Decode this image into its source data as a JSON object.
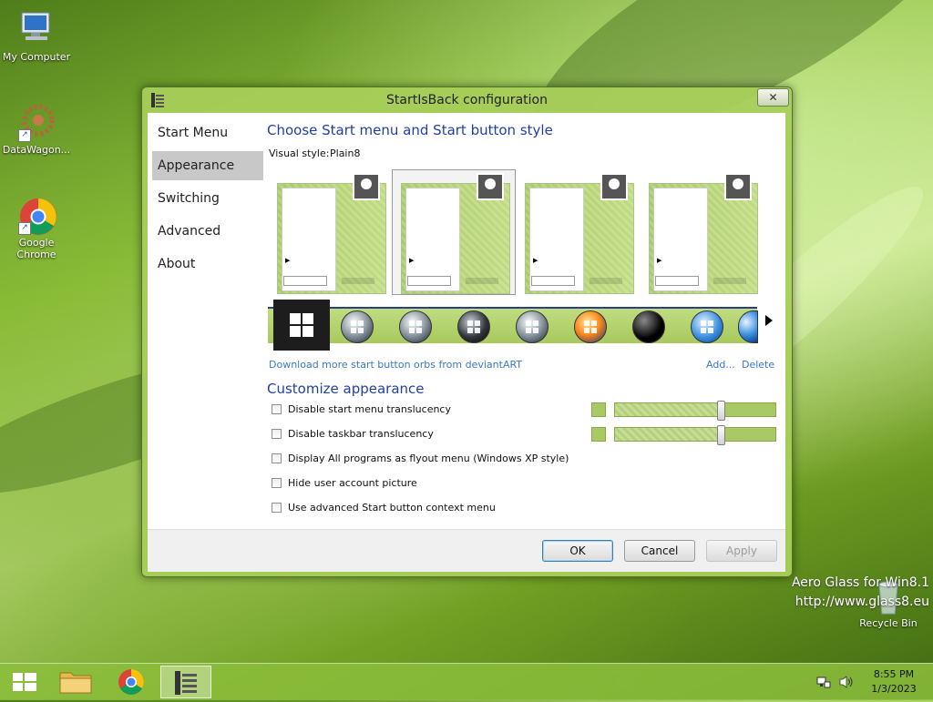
{
  "desktop": {
    "icons": [
      {
        "label": "My Computer"
      },
      {
        "label": "DataWagon..."
      },
      {
        "label": "Google Chrome"
      },
      {
        "label": "Recycle Bin"
      }
    ],
    "watermark": {
      "line1": "Aero Glass for Win8.1",
      "line2": "http://www.glass8.eu"
    }
  },
  "window": {
    "title": "StartIsBack configuration",
    "close_glyph": "✕",
    "nav": {
      "items": [
        {
          "label": "Start Menu"
        },
        {
          "label": "Appearance"
        },
        {
          "label": "Switching"
        },
        {
          "label": "Advanced"
        },
        {
          "label": "About"
        }
      ],
      "selected": "Appearance"
    },
    "style_section": {
      "heading": "Choose Start menu and Start button style",
      "visual_style_label": "Visual style:",
      "visual_style_value": "Plain8",
      "selected_preview_index": 1,
      "orbs_link": "Download more start button orbs from deviantART",
      "add_link": "Add...",
      "delete_link": "Delete"
    },
    "customize_section": {
      "heading": "Customize appearance",
      "options": [
        {
          "label": "Disable start menu translucency",
          "checked": false
        },
        {
          "label": "Disable taskbar translucency",
          "checked": false
        },
        {
          "label": "Display All programs as flyout menu (Windows XP style)",
          "checked": false
        },
        {
          "label": "Hide user account picture",
          "checked": false
        },
        {
          "label": "Use advanced Start button context menu",
          "checked": false
        }
      ],
      "menu_translucency_level": 0.66,
      "taskbar_translucency_level": 0.66,
      "tint_color": "#a8c964"
    },
    "buttons": {
      "ok": "OK",
      "cancel": "Cancel",
      "apply": "Apply"
    }
  },
  "taskbar": {
    "time": "8:55 PM",
    "date": "1/3/2023",
    "accent": "#8cbe3c"
  }
}
